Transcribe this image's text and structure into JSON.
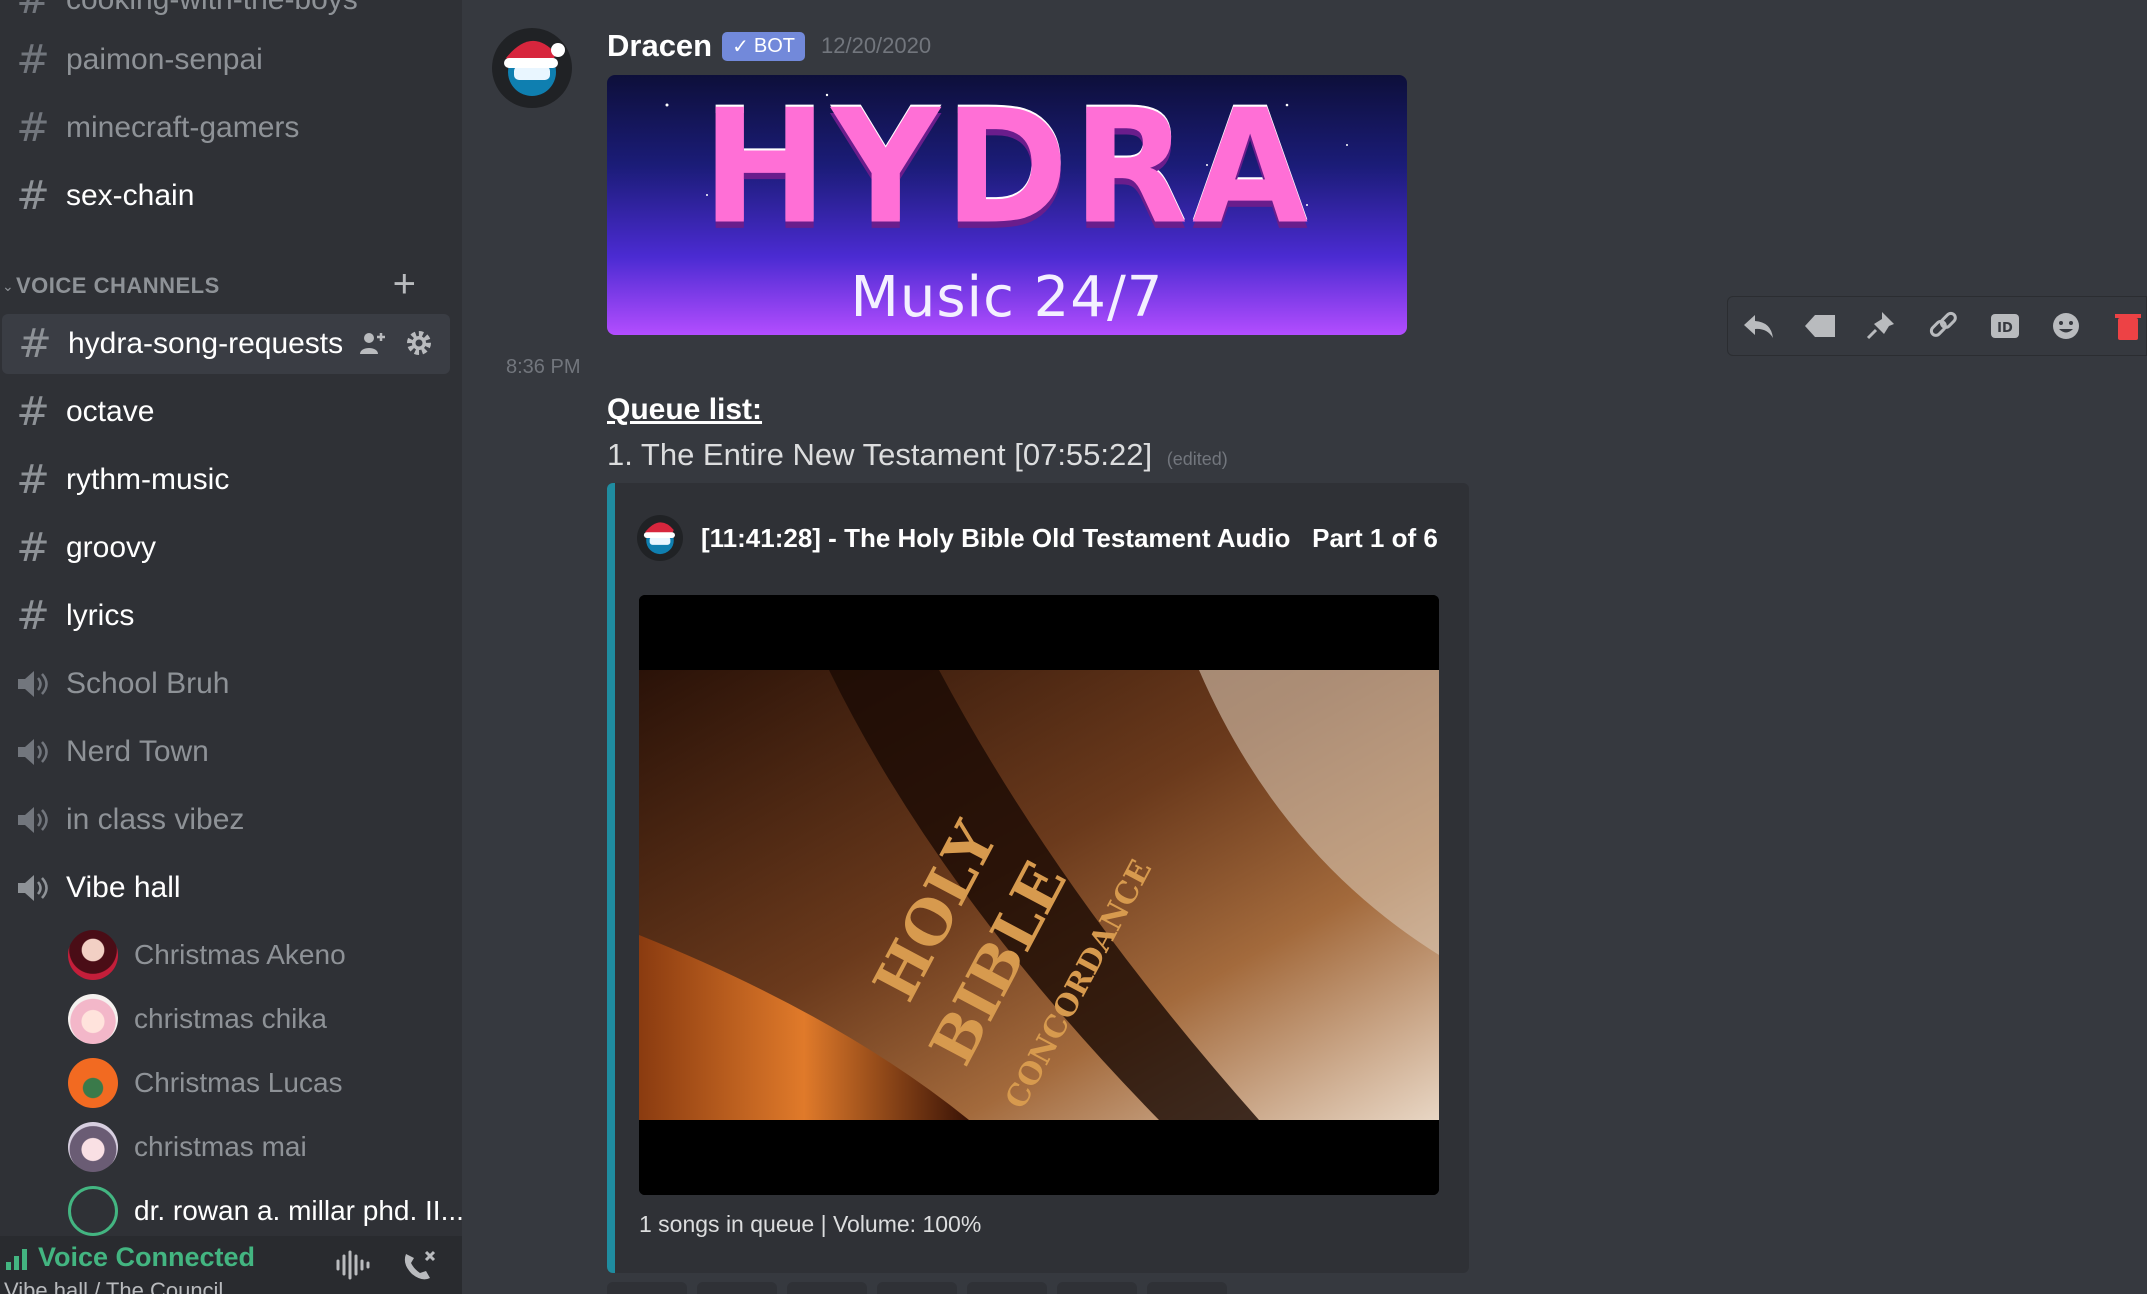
{
  "sidebar": {
    "top_channel_partial": "cooking-with-the-boys",
    "text_channels": [
      {
        "name": "paimon-senpai"
      },
      {
        "name": "minecraft-gamers"
      },
      {
        "name": "sex-chain"
      }
    ],
    "voice_category_label": "VOICE CHANNELS",
    "voice_channels": [
      {
        "name": "hydra-song-requests"
      },
      {
        "name": "octave"
      },
      {
        "name": "rythm-music"
      },
      {
        "name": "groovy"
      },
      {
        "name": "lyrics"
      },
      {
        "name": "School Bruh"
      },
      {
        "name": "Nerd Town"
      },
      {
        "name": "in class vibez"
      },
      {
        "name": "Vibe hall"
      }
    ],
    "voice_users": [
      {
        "name": "Christmas Akeno"
      },
      {
        "name": "christmas chika"
      },
      {
        "name": "Christmas Lucas"
      },
      {
        "name": "christmas mai"
      },
      {
        "name": "dr. rowan a. millar phd. II..."
      }
    ],
    "voice_panel": {
      "status": "Voice Connected",
      "location": "Vibe hall / The Council"
    }
  },
  "message": {
    "author": "Dracen",
    "bot_tag": "BOT",
    "timestamp": "12/20/2020",
    "banner": {
      "title": "HYDRA",
      "subtitle": "Music 24/7"
    },
    "side_time": "8:36 PM",
    "queue_title": "Queue list:",
    "queue_item": "1. The Entire New Testament [07:55:22]",
    "edited_label": "(edited)",
    "embed": {
      "author": "[11:41:28] - The Holy Bible Old Testament Audio   Part 1 of 6",
      "image_text": {
        "line1": "HOLY",
        "line2": "BIBLE",
        "line3": "CONCORDANCE"
      },
      "footer": "1 songs in queue | Volume: 100%",
      "accent": "#1f8ca0"
    }
  },
  "toolbar": [
    "reply-icon",
    "tag-icon",
    "pin-icon",
    "link-icon",
    "id-icon",
    "emoji-icon",
    "delete-icon"
  ],
  "colors": {
    "bot_tag": "#7289da",
    "voice_connected": "#43b581",
    "delete": "#ed4245"
  }
}
